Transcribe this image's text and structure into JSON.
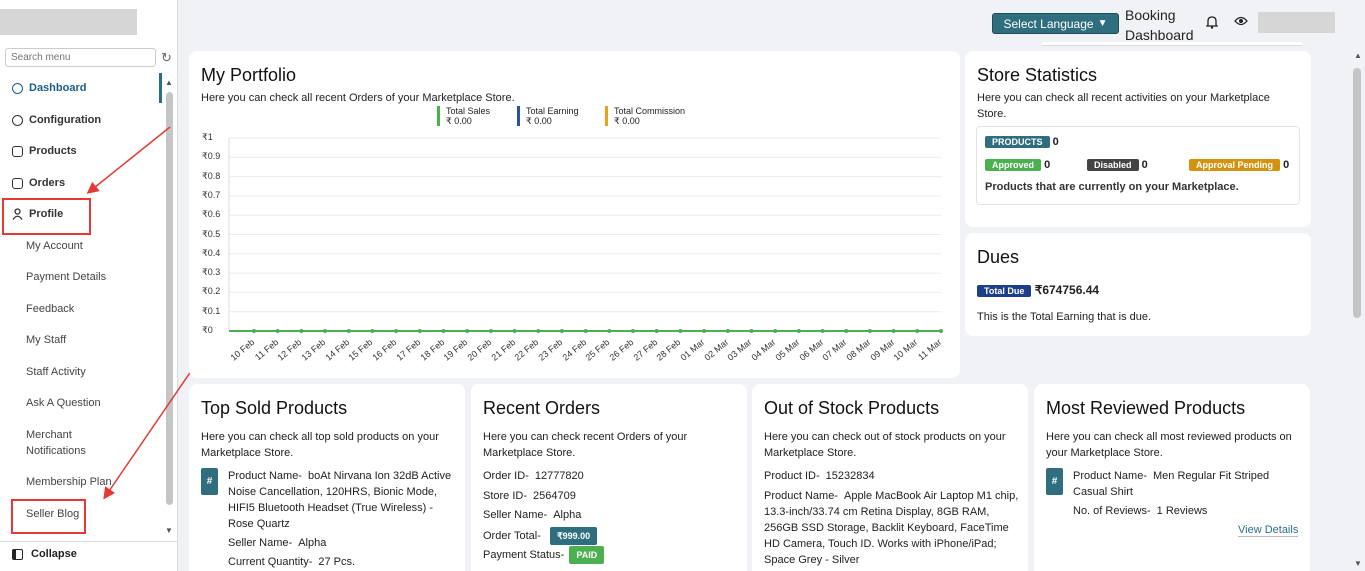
{
  "sidebar": {
    "search_placeholder": "Search menu",
    "items": [
      {
        "label": "Dashboard",
        "icon": "dashboard-icon",
        "top": 88
      },
      {
        "label": "Configuration",
        "icon": "gear-icon",
        "top": 120
      },
      {
        "label": "Products",
        "icon": "products-icon",
        "top": 151
      },
      {
        "label": "Orders",
        "icon": "orders-icon",
        "top": 183
      },
      {
        "label": "Profile",
        "icon": "user-icon",
        "top": 214
      }
    ],
    "sub_items": [
      "My Account",
      "Payment Details",
      "Feedback",
      "My Staff",
      "Staff Activity",
      "Ask A Question",
      "Merchant Notifications",
      "Membership Plan",
      "Seller Blog"
    ],
    "collapse_label": "Collapse"
  },
  "topbar": {
    "language_label": "Select Language",
    "booking_line1": "Booking",
    "booking_line2": "Dashboard"
  },
  "portfolio": {
    "title": "My Portfolio",
    "desc": "Here you can check all recent Orders of your Marketplace Store.",
    "legend": [
      {
        "name": "Total Sales",
        "value": "₹ 0.00",
        "color": "#4caf50"
      },
      {
        "name": "Total Earning",
        "value": "₹ 0.00",
        "color": "#2c4fa8"
      },
      {
        "name": "Total Commission",
        "value": "₹ 0.00",
        "color": "#e8a317"
      }
    ]
  },
  "chart_data": {
    "type": "line",
    "x": [
      "10 Feb",
      "11 Feb",
      "12 Feb",
      "13 Feb",
      "14 Feb",
      "15 Feb",
      "16 Feb",
      "17 Feb",
      "18 Feb",
      "19 Feb",
      "20 Feb",
      "21 Feb",
      "22 Feb",
      "23 Feb",
      "24 Feb",
      "25 Feb",
      "26 Feb",
      "27 Feb",
      "28 Feb",
      "01 Mar",
      "02 Mar",
      "03 Mar",
      "04 Mar",
      "05 Mar",
      "06 Mar",
      "07 Mar",
      "08 Mar",
      "09 Mar",
      "10 Mar",
      "11 Mar"
    ],
    "yticks": [
      "₹1",
      "₹0.9",
      "₹0.8",
      "₹0.7",
      "₹0.6",
      "₹0.5",
      "₹0.4",
      "₹0.3",
      "₹0.2",
      "₹0.1",
      "₹0"
    ],
    "ylim": [
      0,
      1
    ],
    "series": [
      {
        "name": "Total Sales",
        "values": [
          0,
          0,
          0,
          0,
          0,
          0,
          0,
          0,
          0,
          0,
          0,
          0,
          0,
          0,
          0,
          0,
          0,
          0,
          0,
          0,
          0,
          0,
          0,
          0,
          0,
          0,
          0,
          0,
          0,
          0
        ],
        "color": "#4caf50"
      }
    ],
    "grid": true
  },
  "store_stats": {
    "title": "Store Statistics",
    "desc": "Here you can check all recent activities on your Marketplace Store.",
    "products_label": "PRODUCTS",
    "products_count": "0",
    "approved_label": "Approved",
    "approved_count": "0",
    "disabled_label": "Disabled",
    "disabled_count": "0",
    "pending_label": "Approval Pending",
    "pending_count": "0",
    "footer": "Products that are currently on your Marketplace."
  },
  "dues": {
    "title": "Dues",
    "badge": "Total Due",
    "amount": "₹674756.44",
    "desc": "This is the Total Earning that is due."
  },
  "top_sold": {
    "title": "Top Sold Products",
    "desc": "Here you can check all top sold products on your Marketplace Store.",
    "product_label": "Product Name-",
    "product_value": "boAt Nirvana Ion 32dB Active Noise Cancellation, 120HRS, Bionic Mode, HIFI5 Bluetooth Headset (True Wireless) - Rose Quartz",
    "seller_label": "Seller Name-",
    "seller_value": "Alpha",
    "qty_label": "Current Quantity-",
    "qty_value": "27 Pcs."
  },
  "recent_orders": {
    "title": "Recent Orders",
    "desc": "Here you can check recent Orders of your Marketplace Store.",
    "order_id_label": "Order ID-",
    "order_id": "12777820",
    "store_id_label": "Store ID-",
    "store_id": "2564709",
    "seller_label": "Seller Name-",
    "seller": "Alpha",
    "total_label": "Order Total-",
    "total": "₹999.00",
    "payment_label": "Payment Status-",
    "payment": "PAID"
  },
  "out_of_stock": {
    "title": "Out of Stock Products",
    "desc": "Here you can check out of stock products on your Marketplace Store.",
    "product_id_label": "Product ID-",
    "product_id": "15232834",
    "product_label": "Product Name-",
    "product_value": "Apple MacBook Air Laptop M1 chip, 13.3-inch/33.74 cm Retina Display, 8GB RAM, 256GB SSD Storage, Backlit Keyboard, FaceTime HD Camera, Touch ID. Works with iPhone/iPad; Space Grey - Silver"
  },
  "most_reviewed": {
    "title": "Most Reviewed Products",
    "desc": "Here you can check all most reviewed products on your Marketplace Store.",
    "product_label": "Product Name-",
    "product_value": "Men Regular Fit Striped Casual Shirt",
    "reviews_label": "No. of Reviews-",
    "reviews_value": "1 Reviews",
    "link": "View Details"
  },
  "hash_symbol": "#"
}
